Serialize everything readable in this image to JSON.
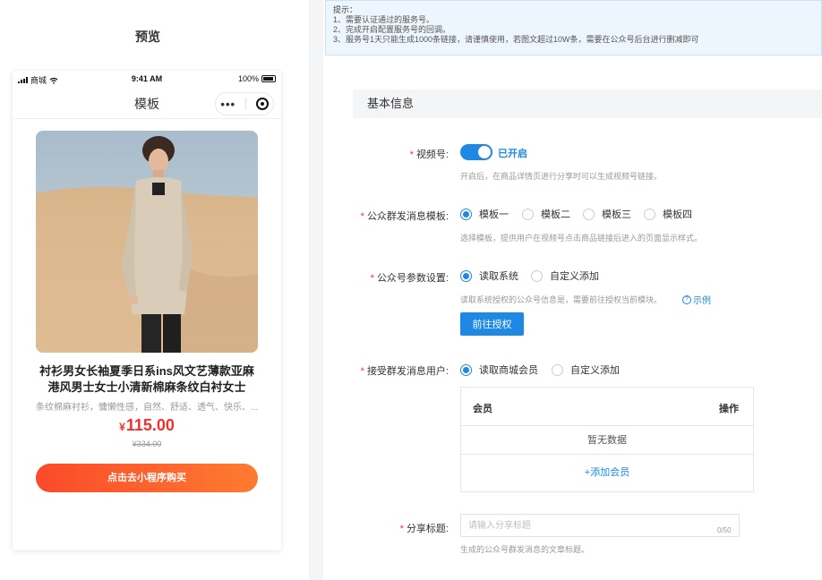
{
  "preview": {
    "title": "预览",
    "status_bar": {
      "carrier": "商城",
      "time": "9:41 AM",
      "battery": "100%"
    },
    "nav_title": "模板",
    "capsule": {
      "more_icon": "more-dots-icon",
      "close_icon": "circle-close-icon"
    },
    "product": {
      "title": "衬衫男女长袖夏季日系ins风文艺薄款亚麻港风男士女士小清新棉麻条纹白衬女士",
      "subtitle": "条纹棉麻衬衫，慵懒性感，自然、舒适、透气、快乐、...",
      "currency": "¥",
      "price": "115.00",
      "original_price": "¥334.00",
      "buy_button": "点击去小程序购买"
    }
  },
  "tips": {
    "heading": "提示：",
    "lines": [
      "1、需要认证通过的服务号。",
      "2、完成开启配置服务号的回调。",
      "3、服务号1天只能生成1000条链接，请谨慎使用，若图文超过10W条，需要在公众号后台进行删减即可"
    ]
  },
  "form": {
    "section_title": "基本信息",
    "video_account": {
      "label": "视频号:",
      "switch_on": true,
      "switch_text": "已开启",
      "hint": "开启后，在商品详情页进行分享时可以生成视频号链接。"
    },
    "template": {
      "label": "公众群发消息模板:",
      "options": [
        "模板一",
        "模板二",
        "模板三",
        "模板四"
      ],
      "selected": "模板一",
      "hint": "选择模板，提供用户在视频号点击商品链接后进入的页面显示样式。"
    },
    "account_params": {
      "label": "公众号参数设置:",
      "options": [
        "读取系统",
        "自定义添加"
      ],
      "selected": "读取系统",
      "hint": "读取系统授权的公众号信息是，需要前往授权当前模块。",
      "example_link": "示例",
      "authorize_button": "前往授权"
    },
    "receivers": {
      "label": "接受群发消息用户:",
      "options": [
        "读取商城会员",
        "自定义添加"
      ],
      "selected": "读取商城会员",
      "table": {
        "headers": [
          "会员",
          "操作"
        ],
        "empty_text": "暂无数据",
        "add_link": "+添加会员"
      }
    },
    "share_title": {
      "label": "分享标题:",
      "placeholder": "请输入分享标题",
      "value": "",
      "counter": "0/50",
      "hint": "生成的公众号群发消息的文章标题。"
    }
  },
  "colors": {
    "primary": "#1e88e5",
    "danger": "#f5302a",
    "buy_gradient_start": "#fb4a2a",
    "buy_gradient_end": "#fe7b30",
    "tips_bg": "#eef6fd"
  }
}
